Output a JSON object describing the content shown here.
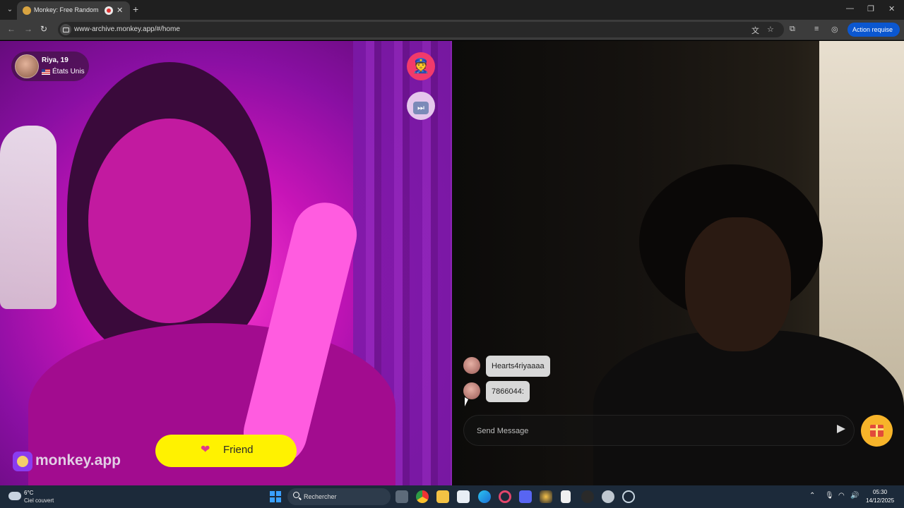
{
  "browser": {
    "tab_title": "Monkey: Free Random Video Chat",
    "tab_close": "✕",
    "new_tab": "+",
    "url": "www-archive.monkey.app/#/home",
    "action_required": "Action requise"
  },
  "profile": {
    "name": "Riya, 19",
    "country": "États Unis"
  },
  "brand": {
    "name": "monkey.app"
  },
  "friend_button": {
    "label": "Friend"
  },
  "chat": {
    "messages": [
      {
        "text": "Hearts4riyaaaa"
      },
      {
        "text": "7866044:"
      }
    ],
    "input_placeholder": "Send Message"
  },
  "taskbar": {
    "weather_temp": "6°C",
    "weather_desc": "Ciel couvert",
    "search_label": "Rechercher",
    "time": "05:30",
    "date": "14/12/2025"
  },
  "colors": {
    "friend_button": "#fff200",
    "report_button": "#f23a6b",
    "gift_button": "#f7b42a",
    "action_button": "#0b57d0",
    "brand_logo": "#8a3cf0"
  },
  "icons": {
    "report": "police-officer-icon",
    "skip": "skip-forward-icon",
    "friend": "heart-icon",
    "send": "send-icon",
    "gift": "gift-icon"
  }
}
